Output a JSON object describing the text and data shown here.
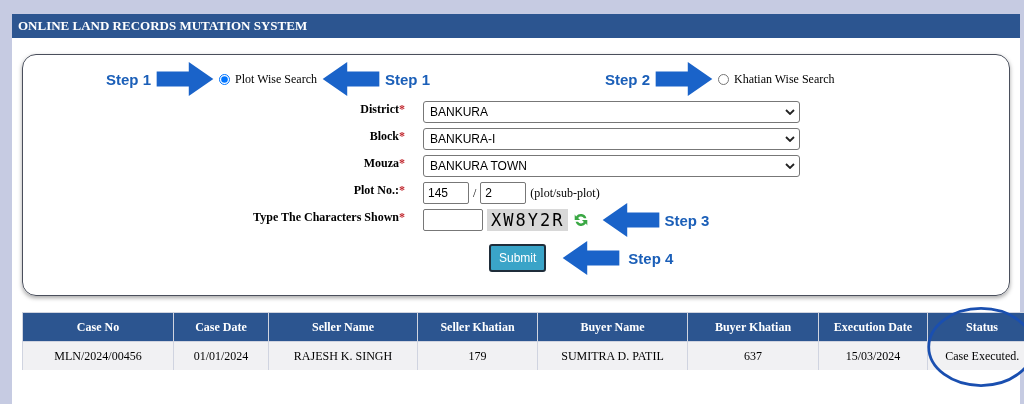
{
  "header": {
    "title": "ONLINE LAND RECORDS MUTATION SYSTEM"
  },
  "search_options": [
    {
      "label": "Plot Wise Search",
      "selected": true
    },
    {
      "label": "Khatian Wise Search",
      "selected": false
    }
  ],
  "steps": {
    "plot_left": "Step 1",
    "plot_right": "Step 1",
    "khatian": "Step 2",
    "captcha": "Step 3",
    "submit": "Step 4"
  },
  "fields": [
    {
      "kind": "select",
      "label": "District",
      "mark": "*",
      "value": "BANKURA"
    },
    {
      "kind": "select",
      "label": "Block",
      "mark": "*",
      "value": "BANKURA-I"
    },
    {
      "kind": "select",
      "label": "Mouza",
      "mark": "*",
      "value": "BANKURA TOWN"
    },
    {
      "kind": "plot",
      "label": "Plot No.:",
      "mark": "*",
      "plot": "145",
      "separator": "/",
      "sub_plot": "2",
      "hint": "(plot/sub-plot)"
    },
    {
      "kind": "captcha",
      "label": "Type The Characters Shown",
      "mark": "*",
      "captcha": "XW8Y2R"
    }
  ],
  "submit": "Submit",
  "table": {
    "columns": [
      {
        "label": "Case No",
        "circled": false
      },
      {
        "label": "Case Date",
        "circled": false
      },
      {
        "label": "Seller Name",
        "circled": false
      },
      {
        "label": "Seller Khatian",
        "circled": false
      },
      {
        "label": "Buyer Name",
        "circled": false
      },
      {
        "label": "Buyer Khatian",
        "circled": false
      },
      {
        "label": "Execution Date",
        "circled": false
      },
      {
        "label": "Status",
        "circled": true
      }
    ],
    "rows": [
      [
        "MLN/2024/00456",
        "01/01/2024",
        "RAJESH K. SINGH",
        "179",
        "SUMITRA D. PATIL",
        "637",
        "15/03/2024",
        "Case Executed."
      ]
    ]
  }
}
